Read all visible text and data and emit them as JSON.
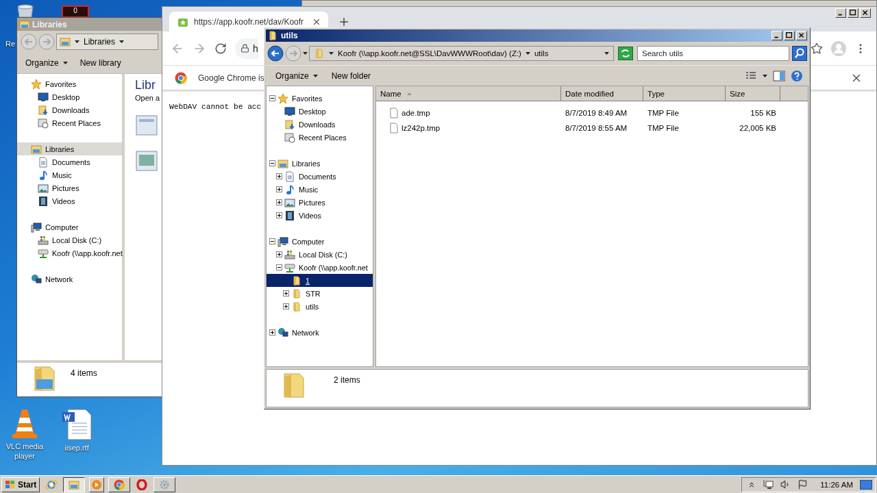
{
  "desktop": {
    "badge": "0",
    "icons": [
      {
        "label": "Re"
      },
      {
        "label": "VLC media player"
      },
      {
        "label": "iisep.rtf"
      }
    ]
  },
  "libraries_window": {
    "title": "Libraries",
    "breadcrumb": "Libraries",
    "toolbar": [
      "Organize",
      "New library"
    ],
    "nav": [
      {
        "label": "Favorites",
        "selected": false,
        "children": [
          {
            "label": "Desktop",
            "selected": false
          },
          {
            "label": "Downloads",
            "selected": false
          },
          {
            "label": "Recent Places",
            "selected": false
          }
        ]
      },
      {
        "label": "Libraries",
        "selected": true,
        "children": [
          {
            "label": "Documents",
            "selected": false
          },
          {
            "label": "Music",
            "selected": false
          },
          {
            "label": "Pictures",
            "selected": false
          },
          {
            "label": "Videos",
            "selected": false
          }
        ]
      },
      {
        "label": "Computer",
        "selected": false,
        "children": [
          {
            "label": "Local Disk (C:)",
            "selected": false
          },
          {
            "label": "Koofr (\\\\app.koofr.net",
            "selected": false
          }
        ]
      },
      {
        "label": "Network",
        "selected": false
      }
    ],
    "heading": "Libr",
    "subtext": "Open a",
    "status": "4 items"
  },
  "chrome": {
    "tab_title": "https://app.koofr.net/dav/Koofr",
    "omnibox": "h",
    "infobar": "Google Chrome is",
    "page_text": "WebDAV cannot be acc"
  },
  "utils_window": {
    "title": "utils",
    "address": [
      "Koofr (\\\\app.koofr.net@SSL\\DavWWWRoot\\dav) (Z:)",
      "utils"
    ],
    "search_placeholder": "Search utils",
    "toolbar": [
      "Organize",
      "New folder"
    ],
    "tree": [
      {
        "label": "Favorites",
        "expanded": true,
        "selected": false,
        "children": [
          {
            "label": "Desktop",
            "selected": false
          },
          {
            "label": "Downloads",
            "selected": false
          },
          {
            "label": "Recent Places",
            "selected": false
          }
        ]
      },
      {
        "label": "Libraries",
        "expanded": true,
        "selected": false,
        "children": [
          {
            "label": "Documents",
            "expanded": false,
            "selected": false
          },
          {
            "label": "Music",
            "expanded": false,
            "selected": false
          },
          {
            "label": "Pictures",
            "expanded": false,
            "selected": false
          },
          {
            "label": "Videos",
            "expanded": false,
            "selected": false
          }
        ]
      },
      {
        "label": "Computer",
        "expanded": true,
        "selected": false,
        "children": [
          {
            "label": "Local Disk (C:)",
            "expanded": false,
            "selected": false
          },
          {
            "label": "Koofr (\\\\app.koofr.net",
            "expanded": true,
            "selected": false,
            "children": [
              {
                "label": "1",
                "selected": true
              },
              {
                "label": "STR",
                "expanded": false,
                "selected": false
              },
              {
                "label": "utils",
                "expanded": false,
                "selected": false
              }
            ]
          }
        ]
      },
      {
        "label": "Network",
        "expanded": false,
        "selected": false
      }
    ],
    "columns": [
      "Name",
      "Date modified",
      "Type",
      "Size"
    ],
    "rows": [
      {
        "name": "ade.tmp",
        "date": "8/7/2019 8:49 AM",
        "type": "TMP File",
        "size": "155 KB"
      },
      {
        "name": "lz242p.tmp",
        "date": "8/7/2019 8:55 AM",
        "type": "TMP File",
        "size": "22,005 KB"
      }
    ],
    "status": "2 items"
  },
  "taskbar": {
    "start": "Start",
    "clock": "11:26 AM"
  }
}
